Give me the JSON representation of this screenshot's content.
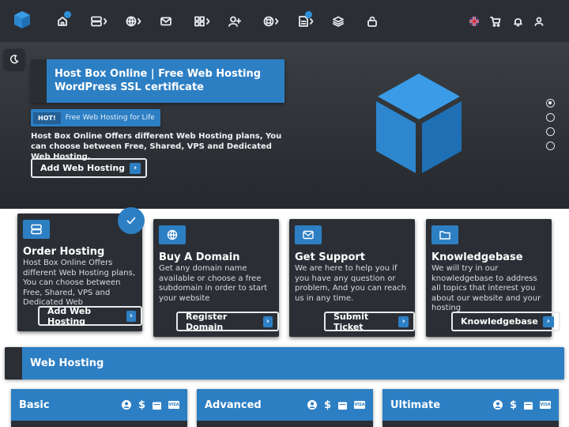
{
  "nav": {
    "icons": [
      "cube-logo-icon",
      "home-icon",
      "server-icon",
      "globe-icon",
      "mail-icon",
      "apps-icon",
      "user-plus-icon",
      "support-icon",
      "document-icon",
      "layers-icon",
      "lock-icon",
      "flag-uk-icon",
      "cart-icon",
      "bell-icon",
      "user-icon"
    ]
  },
  "hero": {
    "title": "Host Box Online | Free Web Hosting WordPress SSL certificate",
    "hot_tag": "HOT!",
    "hot_text": "Free Web Hosting for Life",
    "description": "Host Box Online Offers different Web Hosting plans, You can choose between Free, Shared, VPS and Dedicated Web Hosting.",
    "cta": "Add Web Hosting",
    "slide_count": 4,
    "active_slide": 1
  },
  "cards": [
    {
      "title": "Order Hosting",
      "text": "Host Box Online Offers different Web Hosting plans, You can choose between Free, Shared, VPS and Dedicated Web",
      "button": "Add Web Hosting",
      "icon": "server-icon"
    },
    {
      "title": "Buy A Domain",
      "text": "Get any domain name available or choose a free subdomain in order to start your website",
      "button": "Register Domain",
      "icon": "globe-icon"
    },
    {
      "title": "Get Support",
      "text": "We are here to help you if you have any question or problem, And you can reach us in any time.",
      "button": "Submit Ticket",
      "icon": "mail-icon"
    },
    {
      "title": "Knowledgebase",
      "text": "We will try in our knowledgebase to address all topics that interest you about our website and your hosting",
      "button": "Knowledgebase",
      "icon": "folder-icon"
    }
  ],
  "section": {
    "title": "Web Hosting"
  },
  "plans": [
    {
      "name": "Basic"
    },
    {
      "name": "Advanced"
    },
    {
      "name": "Ultimate"
    }
  ],
  "payment_icons": [
    "user-circle-icon",
    "dollar-icon",
    "calendar-icon",
    "visa-icon"
  ],
  "visa_text": "VISA",
  "colors": {
    "accent": "#2d7fc4",
    "dark": "#2b2f35"
  }
}
